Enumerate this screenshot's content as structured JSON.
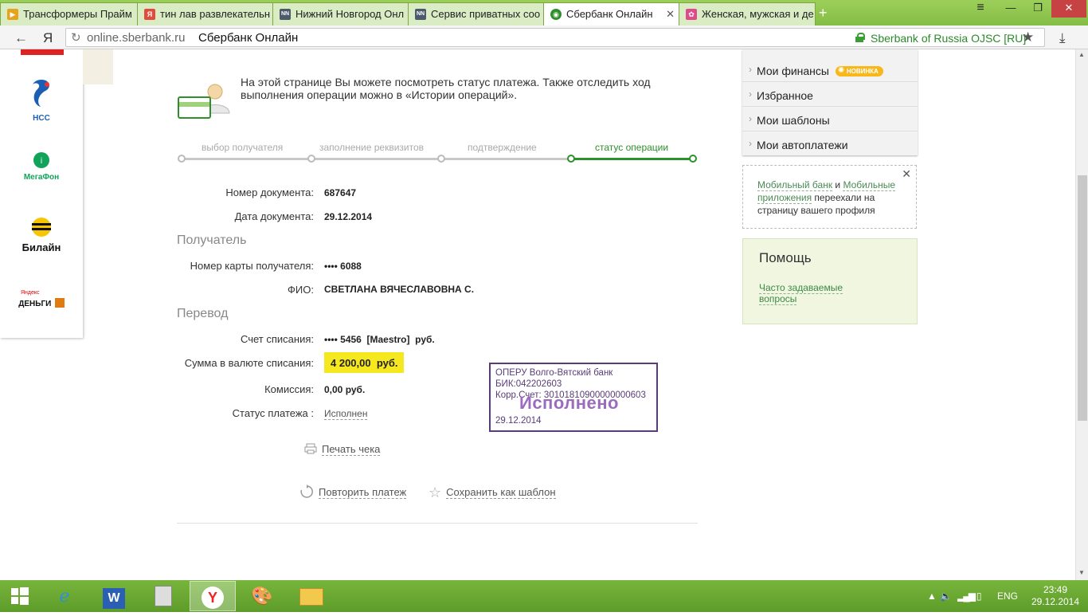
{
  "browser": {
    "tabs": [
      {
        "title": "Трансформеры Прайм",
        "fav_color": "#e8a21c",
        "fav_text": "▶"
      },
      {
        "title": "тин лав развлекательн",
        "fav_color": "#e24a3b",
        "fav_text": "Я"
      },
      {
        "title": "Нижний Новгород Онл",
        "fav_color": "#4b5b6b",
        "fav_text": "NN"
      },
      {
        "title": "Сервис приватных соо",
        "fav_color": "#4b5b6b",
        "fav_text": "NN"
      },
      {
        "title": "Сбербанк Онлайн",
        "fav_color": "#2e8f2b",
        "fav_text": "◉"
      },
      {
        "title": "Женская, мужская и де",
        "fav_color": "#e04a8c",
        "fav_text": "✿"
      }
    ],
    "back": "←",
    "yandex": "Я",
    "url_host": "online.sberbank.ru",
    "page_title": "Сбербанк Онлайн",
    "cert": "Sberbank of Russia OJSC [RU]",
    "star": "★",
    "download": "⤓",
    "refresh": "↻",
    "new_tab": "+",
    "menu": "≡",
    "minimize": "—",
    "restore": "❐",
    "close": "✕"
  },
  "providers": [
    {
      "label": "НСС",
      "color": "#1a5fb4",
      "glyph": "∂"
    },
    {
      "label": "МегаФон",
      "color": "#12a35a",
      "glyph": "◉"
    },
    {
      "label": "Билайн",
      "color": "#111",
      "glyph": "●"
    },
    {
      "label": "ДЕНЬГИ",
      "small": "Яндекс",
      "color": "#e07b12",
      "glyph": "◪"
    }
  ],
  "intro": "На этой странице Вы можете посмотреть статус платежа. Также отследить ход выполнения операции можно в «Истории операций».",
  "steps": [
    "выбор получателя",
    "заполнение реквизитов",
    "подтверждение",
    "статус операции"
  ],
  "details": {
    "doc_number_label": "Номер документа:",
    "doc_number": "687647",
    "doc_date_label": "Дата документа:",
    "doc_date": "29.12.2014",
    "recipient_section": "Получатель",
    "card_label": "Номер карты получателя:",
    "card": "•••• 6088",
    "fio_label": "ФИО:",
    "fio": "СВЕТЛАНА ВЯЧЕСЛАВОВНА С.",
    "transfer_section": "Перевод",
    "account_label": "Счет списания:",
    "account": "•••• 5456  [Maestro]  руб.",
    "amount_label": "Сумма в валюте списания:",
    "amount": "4 200,00  руб.",
    "fee_label": "Комиссия:",
    "fee": "0,00 руб.",
    "status_label": "Статус платежа :",
    "status": "Исполнен"
  },
  "stamp": {
    "line1": "ОПЕРУ Волго-Вятский банк",
    "line2": "БИК:042202603",
    "line3": "Корр.Счет: 30101810900000000603",
    "big": "Исполнено",
    "date": "29.12.2014"
  },
  "actions": {
    "print": "Печать чека",
    "repeat": "Повторить платеж",
    "save_template": "Сохранить как шаблон"
  },
  "right_menu": [
    {
      "label": "Мои финансы",
      "badge": "НОВИНКА"
    },
    {
      "label": "Избранное"
    },
    {
      "label": "Мои шаблоны"
    },
    {
      "label": "Мои автоплатежи"
    }
  ],
  "notice": {
    "link1": "Мобильный банк",
    "and": " и ",
    "link2": "Мобильные приложения",
    "rest": " переехали на страницу вашего профиля",
    "close": "✕"
  },
  "help": {
    "title": "Помощь",
    "faq": "Часто задаваемые вопросы"
  },
  "taskbar": {
    "lang": "ENG",
    "time": "23:49",
    "date": "29.12.2014"
  },
  "colors": {
    "brand_green": "#2e8f2b",
    "amount_highlight": "#f6e81f",
    "stamp": "#5a3c78"
  }
}
